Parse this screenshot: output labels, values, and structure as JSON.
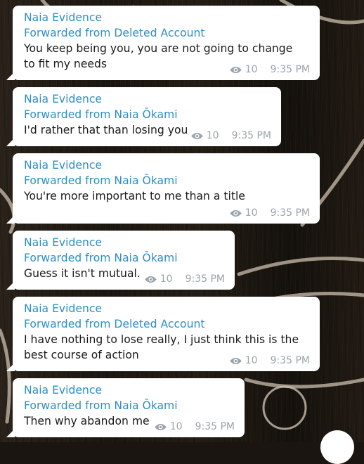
{
  "chat": {
    "messages": [
      {
        "sender": "Naia Evidence",
        "forwarded": "Forwarded from Deleted Account",
        "text": "You keep being you, you are not going to change to fit my needs",
        "views": "10",
        "time": "9:35 PM"
      },
      {
        "sender": "Naia Evidence",
        "forwarded": "Forwarded from Naia Ōkami",
        "text": "I'd rather that than losing you",
        "views": "10",
        "time": "9:35 PM"
      },
      {
        "sender": "Naia Evidence",
        "forwarded": "Forwarded from Naia Ōkami",
        "text": "You're more important to me than a title",
        "views": "10",
        "time": "9:35 PM"
      },
      {
        "sender": "Naia Evidence",
        "forwarded": "Forwarded from Naia Ōkami",
        "text": "Guess it isn't mutual.",
        "views": "10",
        "time": "9:35 PM"
      },
      {
        "sender": "Naia Evidence",
        "forwarded": "Forwarded from Deleted Account",
        "text": "I have nothing to lose really, I just think this is the best course of action",
        "views": "10",
        "time": "9:35 PM"
      },
      {
        "sender": "Naia Evidence",
        "forwarded": "Forwarded from Naia Ōkami",
        "text": "Then why abandon me",
        "views": "10",
        "time": "9:35 PM"
      }
    ]
  },
  "icons": {
    "views": "eye-icon"
  },
  "colors": {
    "sender": "#2e8fc7",
    "bubble": "#ffffff",
    "meta": "#9ba4ab"
  }
}
